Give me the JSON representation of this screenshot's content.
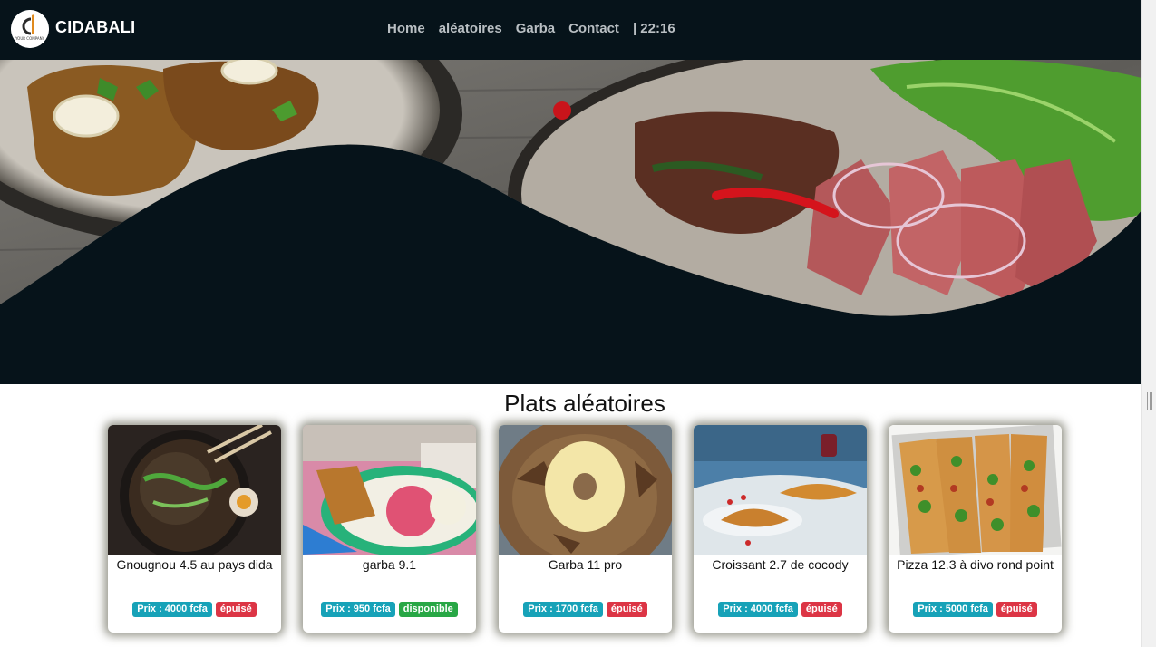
{
  "header": {
    "brand": "CIDABALI",
    "logo_text": "YOUR COMPANY"
  },
  "nav": {
    "items": [
      "Home",
      "aléatoires",
      "Garba",
      "Contact"
    ],
    "time": "| 22:16"
  },
  "section": {
    "title": "Plats aléatoires"
  },
  "cards": [
    {
      "name": "Gnougnou 4.5 au pays dida",
      "price": "Prix : 4000 fcfa",
      "status": "épuisé"
    },
    {
      "name": "garba 9.1",
      "price": "Prix : 950 fcfa",
      "status": "disponible"
    },
    {
      "name": "Garba 11 pro",
      "price": "Prix : 1700 fcfa",
      "status": "épuisé"
    },
    {
      "name": "Croissant 2.7 de cocody",
      "price": "Prix : 4000 fcfa",
      "status": "épuisé"
    },
    {
      "name": "Pizza 12.3 à divo rond point",
      "price": "Prix : 5000 fcfa",
      "status": "épuisé"
    }
  ],
  "colors": {
    "navbar": "#06131a",
    "price_badge": "#17a2b8",
    "out_badge": "#dc3545",
    "in_badge": "#28a745"
  }
}
